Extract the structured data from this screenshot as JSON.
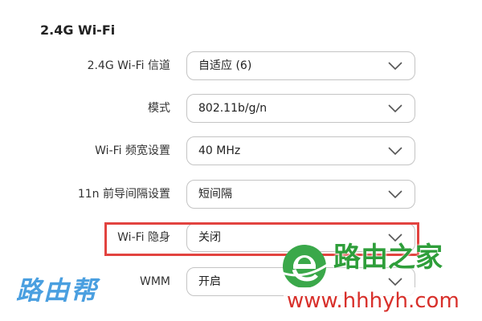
{
  "section": {
    "title": "2.4G Wi-Fi"
  },
  "settings": [
    {
      "label": "2.4G Wi-Fi 信道",
      "value": "自适应 (6)"
    },
    {
      "label": "模式",
      "value": "802.11b/g/n"
    },
    {
      "label": "Wi-Fi 频宽设置",
      "value": "40 MHz"
    },
    {
      "label": "11n 前导间隔设置",
      "value": "短间隔"
    },
    {
      "label": "Wi-Fi 隐身",
      "value": "关闭"
    },
    {
      "label": "WMM",
      "value": "开启"
    }
  ],
  "icons": {
    "dropdown": "chevron-down-icon",
    "logo": "e-logo-icon"
  },
  "colors": {
    "highlight": "#e2433f",
    "watermark_left": "#4a9fe0",
    "watermark_brand": "#2e9e3a",
    "watermark_url": "#d8302b"
  },
  "watermarks": {
    "left_text": "路由帮",
    "brand_text": "路由之家",
    "url_text": "www.hhhyh.com"
  }
}
